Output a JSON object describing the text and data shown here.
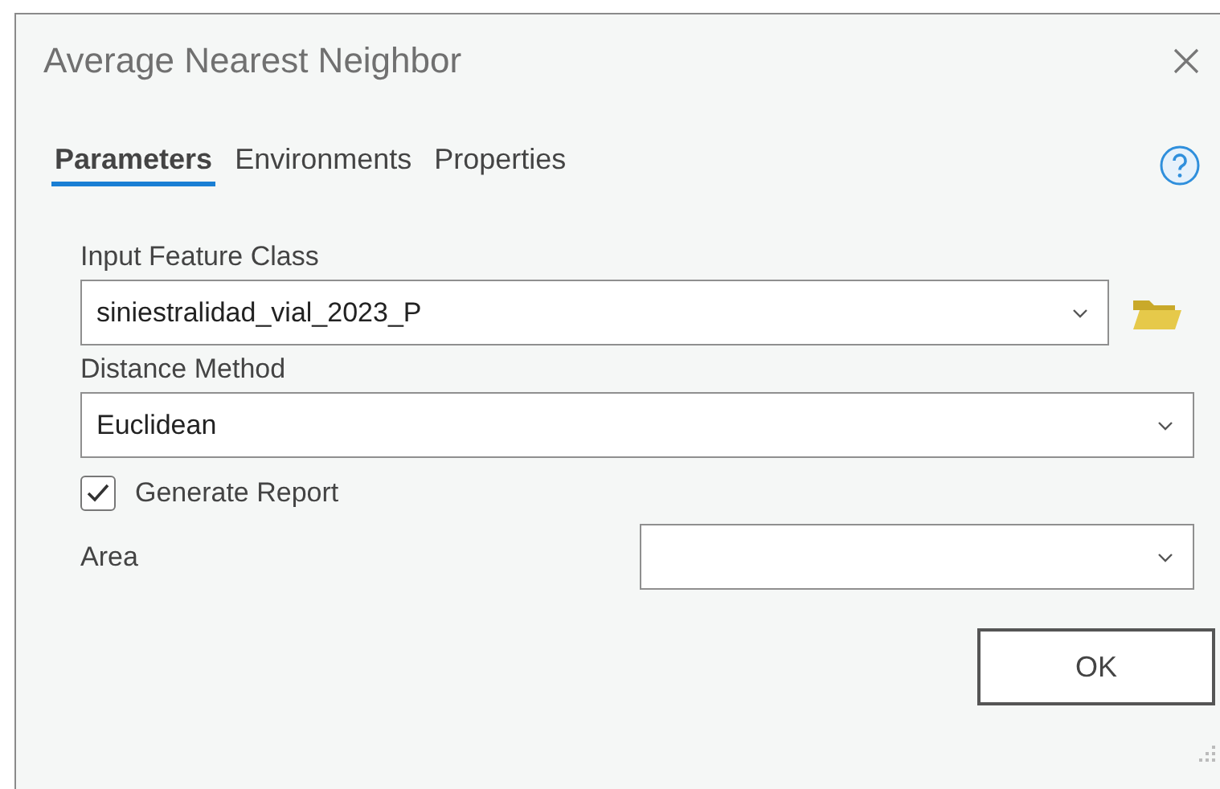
{
  "window": {
    "title": "Average Nearest Neighbor"
  },
  "tabs": [
    {
      "label": "Parameters",
      "selected": true
    },
    {
      "label": "Environments",
      "selected": false
    },
    {
      "label": "Properties",
      "selected": false
    }
  ],
  "parameters": [
    {
      "kind": "dropdown",
      "label": "Input Feature Class",
      "value": "siniestralidad_vial_2023_P",
      "browse": true
    },
    {
      "kind": "dropdown",
      "label": "Distance Method",
      "value": "Euclidean",
      "browse": false
    },
    {
      "kind": "checkbox",
      "label": "Generate Report",
      "checked": true
    },
    {
      "kind": "inline-dropdown",
      "label": "Area"
    }
  ],
  "buttons": [
    "OK"
  ]
}
